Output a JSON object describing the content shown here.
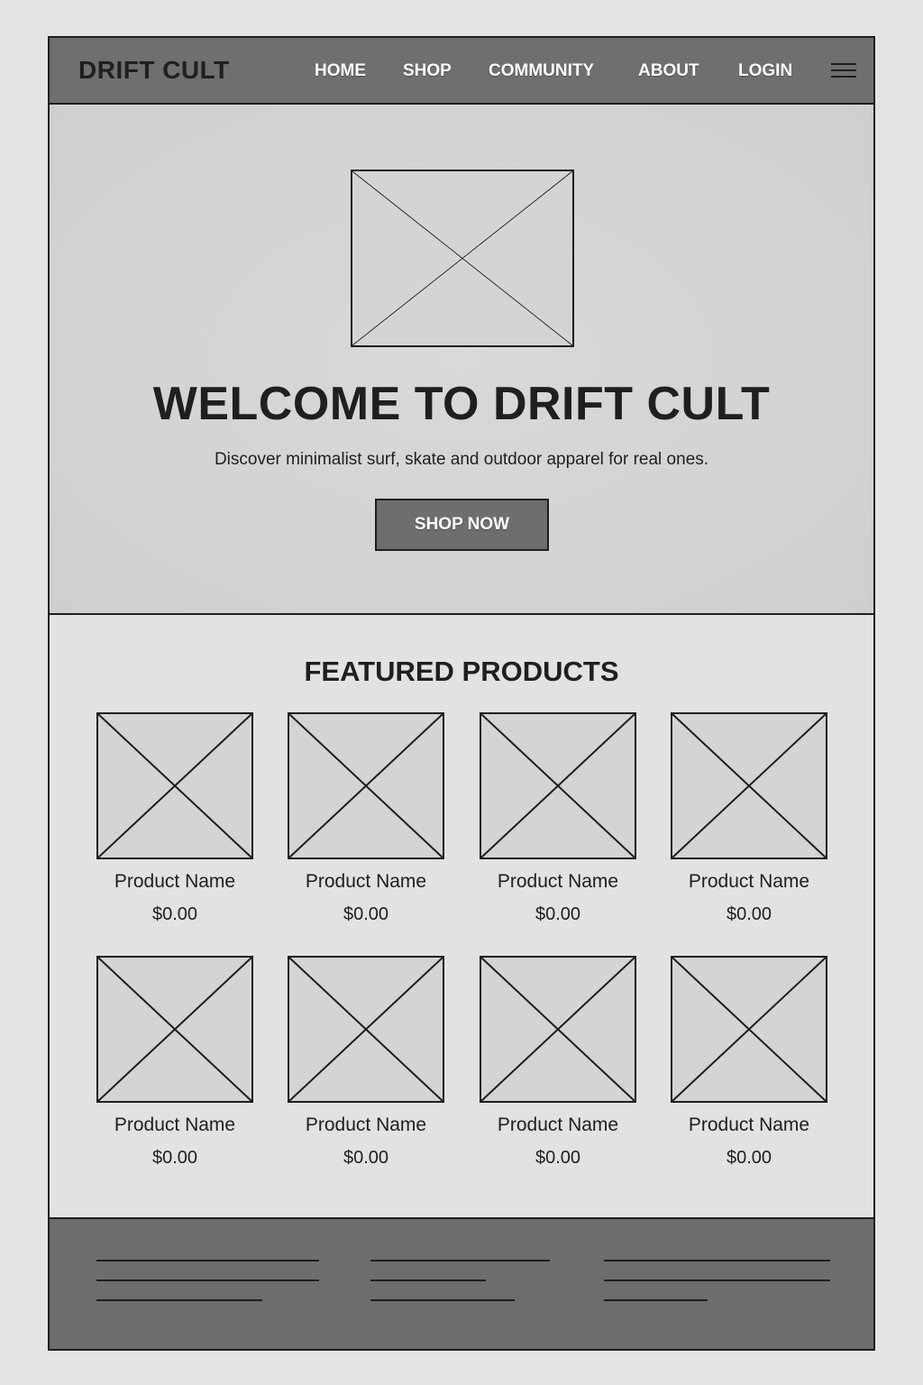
{
  "header": {
    "brand": "DRIFT CULT",
    "nav": [
      "HOME",
      "SHOP",
      "COMMUNITY",
      "ABOUT",
      "LOGIN"
    ],
    "menu_icon": "hamburger-menu-icon"
  },
  "hero": {
    "image_icon": "image-placeholder-icon",
    "title": "WELCOME TO DRIFT CULT",
    "subtitle": "Discover minimalist surf, skate and outdoor apparel for real ones.",
    "cta_label": "SHOP NOW"
  },
  "featured": {
    "title": "FEATURED PRODUCTS",
    "products": [
      {
        "name": "Product Name",
        "price": "$0.00"
      },
      {
        "name": "Product Name",
        "price": "$0.00"
      },
      {
        "name": "Product Name",
        "price": "$0.00"
      },
      {
        "name": "Product Name",
        "price": "$0.00"
      },
      {
        "name": "Product Name",
        "price": "$0.00"
      },
      {
        "name": "Product Name",
        "price": "$0.00"
      },
      {
        "name": "Product Name",
        "price": "$0.00"
      },
      {
        "name": "Product Name",
        "price": "$0.00"
      }
    ]
  },
  "colors": {
    "header_bg": "#6f6f6f",
    "hero_bg": "#d2d2d2",
    "page_bg": "#e2e2e2",
    "footer_bg": "#6d6d6d",
    "cta_bg": "#6e6e6e",
    "ink": "#1e1e1e"
  }
}
